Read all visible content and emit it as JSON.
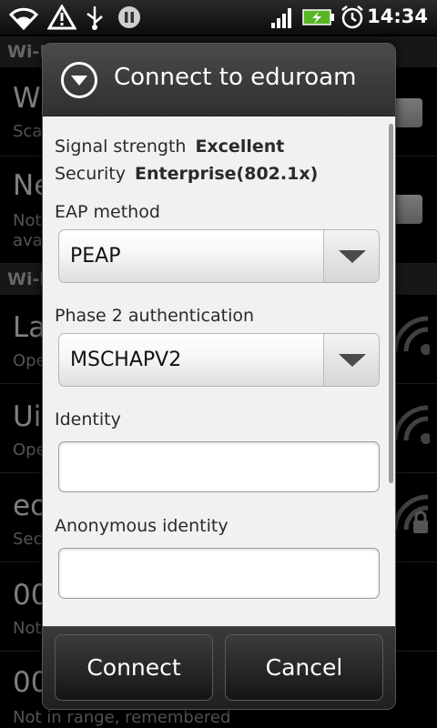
{
  "status_bar": {
    "time": "14:34",
    "icons": [
      "wifi-signal-icon",
      "warning-icon",
      "usb-icon",
      "sync-paused-icon",
      "cell-signal-icon",
      "battery-charging-icon",
      "alarm-clock-icon"
    ]
  },
  "background": {
    "section1": "Wi-F",
    "section2": "Wi-F",
    "rows": [
      {
        "title": "Wi",
        "sub": "Sca"
      },
      {
        "title": "Ne",
        "sub": "Not",
        "sub2": "ava"
      },
      {
        "title": "La",
        "sub": "Ope"
      },
      {
        "title": "Ui",
        "sub": "Ope"
      },
      {
        "title": "eo",
        "sub": "Sec"
      },
      {
        "title": "00",
        "sub": "Not"
      },
      {
        "title": "00",
        "sub": "Not in range, remembered"
      }
    ]
  },
  "dialog": {
    "title": "Connect to eduroam",
    "signal_label": "Signal strength",
    "signal_value": "Excellent",
    "security_label": "Security",
    "security_value": "Enterprise(802.1x)",
    "eap_label": "EAP method",
    "eap_value": "PEAP",
    "phase2_label": "Phase 2 authentication",
    "phase2_value": "MSCHAPV2",
    "identity_label": "Identity",
    "identity_value": "",
    "anon_label": "Anonymous identity",
    "anon_value": "",
    "connect_label": "Connect",
    "cancel_label": "Cancel"
  },
  "colors": {
    "accent_green": "#5ab526",
    "dialog_body": "#f1f1f1",
    "header": "#3b3b3b"
  }
}
